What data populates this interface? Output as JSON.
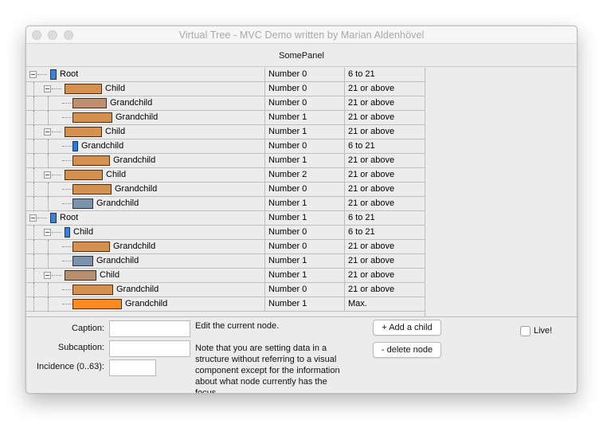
{
  "window": {
    "title": "Virtual Tree - MVC Demo written by Marian Aldenhövel",
    "panel_title": "SomePanel"
  },
  "tree": {
    "rows": [
      {
        "depth": 0,
        "expander": true,
        "label": "Root",
        "color": "#3b82d6",
        "barw": 8,
        "number": "Number 0",
        "range": "6 to 21"
      },
      {
        "depth": 1,
        "expander": true,
        "label": "Child",
        "color": "#d4914f",
        "barw": 47,
        "number": "Number 0",
        "range": "21 or above"
      },
      {
        "depth": 2,
        "expander": false,
        "label": "Grandchild",
        "color": "#bf9070",
        "barw": 43,
        "number": "Number 0",
        "range": "21 or above"
      },
      {
        "depth": 2,
        "expander": false,
        "label": "Grandchild",
        "color": "#d4914f",
        "barw": 50,
        "number": "Number 1",
        "range": "21 or above"
      },
      {
        "depth": 1,
        "expander": true,
        "label": "Child",
        "color": "#d4914f",
        "barw": 47,
        "number": "Number 1",
        "range": "21 or above"
      },
      {
        "depth": 2,
        "expander": false,
        "label": "Grandchild",
        "color": "#2f7ad9",
        "barw": 7,
        "number": "Number 0",
        "range": "6 to 21"
      },
      {
        "depth": 2,
        "expander": false,
        "label": "Grandchild",
        "color": "#d4914f",
        "barw": 47,
        "number": "Number 1",
        "range": "21 or above"
      },
      {
        "depth": 1,
        "expander": true,
        "label": "Child",
        "color": "#d4914f",
        "barw": 48,
        "number": "Number 2",
        "range": "21 or above"
      },
      {
        "depth": 2,
        "expander": false,
        "label": "Grandchild",
        "color": "#d4914f",
        "barw": 49,
        "number": "Number 0",
        "range": "21 or above"
      },
      {
        "depth": 2,
        "expander": false,
        "label": "Grandchild",
        "color": "#7b92ab",
        "barw": 26,
        "number": "Number 1",
        "range": "21 or above"
      },
      {
        "depth": 0,
        "expander": true,
        "label": "Root",
        "color": "#3b82d6",
        "barw": 8,
        "number": "Number 1",
        "range": "6 to 21"
      },
      {
        "depth": 1,
        "expander": true,
        "label": "Child",
        "color": "#3b82d6",
        "barw": 7,
        "number": "Number 0",
        "range": "6 to 21"
      },
      {
        "depth": 2,
        "expander": false,
        "label": "Grandchild",
        "color": "#d4914f",
        "barw": 47,
        "number": "Number 0",
        "range": "21 or above"
      },
      {
        "depth": 2,
        "expander": false,
        "label": "Grandchild",
        "color": "#7b92ab",
        "barw": 26,
        "number": "Number 1",
        "range": "21 or above"
      },
      {
        "depth": 1,
        "expander": true,
        "label": "Child",
        "color": "#b88e70",
        "barw": 40,
        "number": "Number 1",
        "range": "21 or above"
      },
      {
        "depth": 2,
        "expander": false,
        "label": "Grandchild",
        "color": "#d4914f",
        "barw": 51,
        "number": "Number 0",
        "range": "21 or above"
      },
      {
        "depth": 2,
        "expander": false,
        "label": "Grandchild",
        "color": "#ff8a1f",
        "barw": 62,
        "number": "Number 1",
        "range": "Max."
      }
    ]
  },
  "form": {
    "caption_label": "Caption:",
    "caption_value": "",
    "subcaption_label": "Subcaption:",
    "subcaption_value": "",
    "incidence_label": "Incidence (0..63):",
    "incidence_value": "",
    "edit_note": "Edit the current node.",
    "structure_note": "Note that you are setting data in a structure without referring to a visual component except for the information about what node currently has the focus.",
    "add_child_button": "+ Add a child",
    "delete_node_button": "- delete node",
    "live_label": "Live!"
  }
}
